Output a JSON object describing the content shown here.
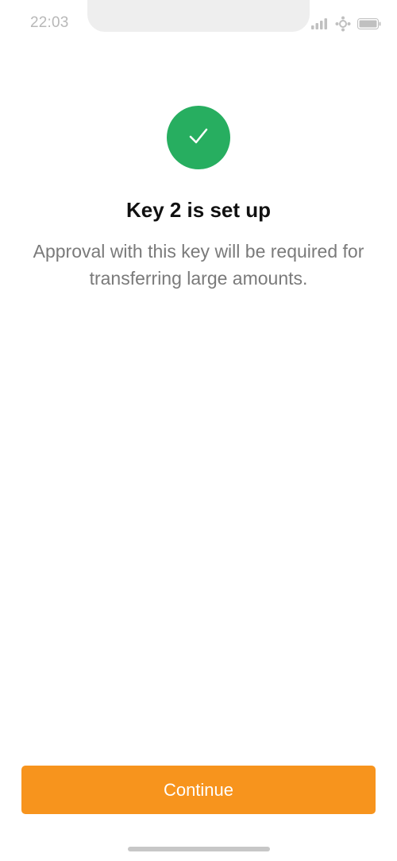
{
  "status_bar": {
    "time": "22:03",
    "icons": [
      "signal-icon",
      "wifi-icon",
      "battery-icon"
    ]
  },
  "success": {
    "icon": "checkmark-icon",
    "color": "#27ae60"
  },
  "title": "Key 2 is set up",
  "description": "Approval with this key will be required for transferring large amounts.",
  "continue_button": {
    "label": "Continue",
    "color": "#f7941d"
  }
}
